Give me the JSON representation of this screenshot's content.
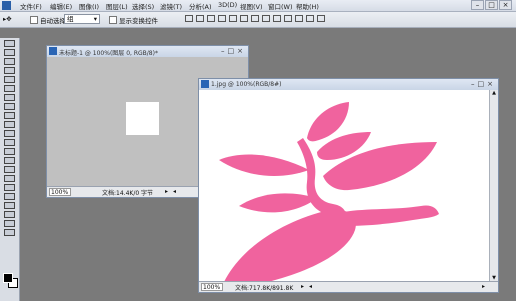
{
  "menubar": {
    "items": [
      "文件(F)",
      "编辑(E)",
      "图像(I)",
      "图层(L)",
      "选择(S)",
      "滤镜(T)",
      "分析(A)",
      "3D(D)",
      "视图(V)",
      "窗口(W)",
      "帮助(H)"
    ]
  },
  "options_bar": {
    "auto_select_label": "自动选择:",
    "auto_select_value": "组",
    "show_transform_label": "显示变换控件"
  },
  "documents": [
    {
      "title": "未标题-1 @ 100%(图层 0, RGB/8)*",
      "zoom": "100%",
      "status": "文档:14.4K/0 字节"
    },
    {
      "title": "1.jpg @ 100%(RGB/8#)",
      "zoom": "100%",
      "status": "文档:717.8K/891.8K"
    }
  ],
  "colors": {
    "foreground": "#000000",
    "background": "#ffffff",
    "flower": "#f0639e"
  }
}
